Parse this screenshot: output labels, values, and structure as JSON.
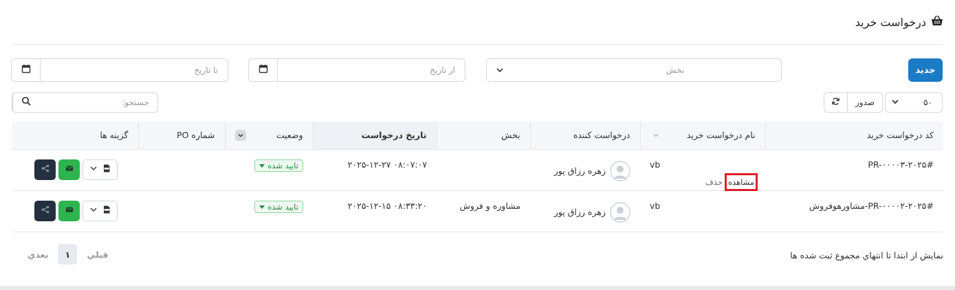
{
  "page": {
    "title": "درخواست خرید"
  },
  "filters": {
    "new_button": "جدید",
    "section_placeholder": "بخش",
    "from_date_placeholder": "از تاریخ",
    "to_date_placeholder": "تا تاریخ",
    "per_page": "۵۰",
    "export_label": "صدور",
    "search_placeholder": "جستجو:"
  },
  "table": {
    "headers": {
      "code": "کد درخواست خرید",
      "name": "نام درخواست خرید",
      "requester": "درخواست کننده",
      "section": "بخش",
      "date": "تاریخ درخواست",
      "status": "وضعیت",
      "po_number": "شماره PO",
      "options": "گزینه ها"
    },
    "rows": [
      {
        "code": "#PR-۰۰۰۰۳-۲۰۲۵",
        "name": "vb",
        "view_link": "مشاهده",
        "delete_link": "حذف",
        "requester": "زهره رزاق پور",
        "section": "",
        "date": "۲۰۲۵-۱۲-۲۷ ۰۸:۰۷:۰۷",
        "status": "تایید شده",
        "po_number": ""
      },
      {
        "code": "#PR-۰۰۰۰۲-۲۰۲۵-مشاورهوفروش",
        "name": "vb",
        "requester": "زهره رزاق پور",
        "section": "مشاوره و فروش",
        "date": "۲۰۲۵-۱۲-۱۵ ۰۸:۳۳:۲۰",
        "status": "تایید شده",
        "po_number": ""
      }
    ]
  },
  "footer": {
    "info": "نمایش از ابتدا تا انتهاي مجموع ثبت شده ها",
    "prev": "قبلي",
    "current_page": "۱",
    "next": "بعدي"
  },
  "colors": {
    "primary": "#1b7bc4",
    "success": "#2db34f",
    "dark": "#24303f",
    "highlight": "#e11d2a"
  }
}
